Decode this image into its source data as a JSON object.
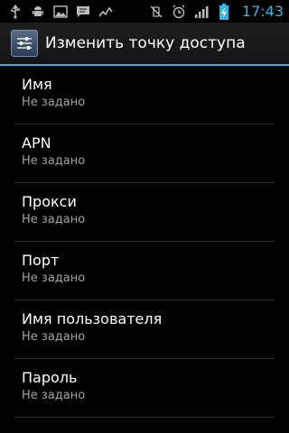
{
  "status_bar": {
    "time": "17:43",
    "left_icons": [
      "usb-icon",
      "android-debug-icon",
      "image-icon",
      "message-icon",
      "activity-icon"
    ],
    "right_icons": [
      "vibrate-mute-icon",
      "alarm-icon",
      "signal-icon",
      "battery-charging-icon"
    ],
    "accent_color": "#33b5e5"
  },
  "action_bar": {
    "icon": "settings-sliders-icon",
    "title": "Изменить точку доступа"
  },
  "preferences": [
    {
      "title": "Имя",
      "summary": "Не задано"
    },
    {
      "title": "APN",
      "summary": "Не задано"
    },
    {
      "title": "Прокси",
      "summary": "Не задано"
    },
    {
      "title": "Порт",
      "summary": "Не задано"
    },
    {
      "title": "Имя пользователя",
      "summary": "Не задано"
    },
    {
      "title": "Пароль",
      "summary": "Не задано"
    }
  ]
}
